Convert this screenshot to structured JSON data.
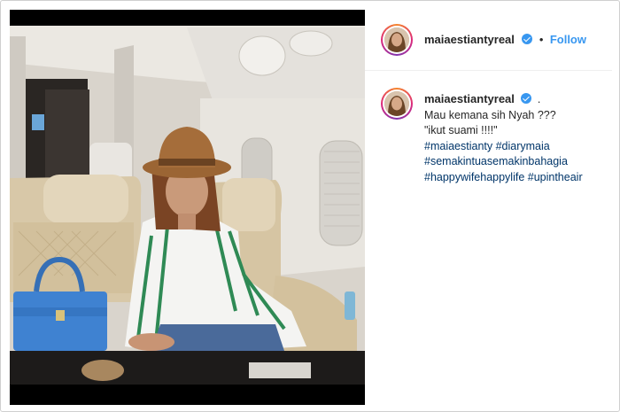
{
  "post": {
    "username": "maiaestiantyreal",
    "follow_label": "Follow",
    "separator": "•",
    "caption_dot": ".",
    "caption_lines": [
      "Mau kemana sih Nyah ???",
      "\"ikut suami !!!!\""
    ],
    "hashtag_lines": [
      "#maiaestianty #diarymaia",
      "#semakintuasemakinbahagia",
      "#happywifehappylife #upintheair"
    ]
  },
  "icons": {
    "verified": "verified-badge-icon"
  },
  "colors": {
    "link": "#3897f0",
    "hashtag": "#003569",
    "text": "#262626"
  }
}
